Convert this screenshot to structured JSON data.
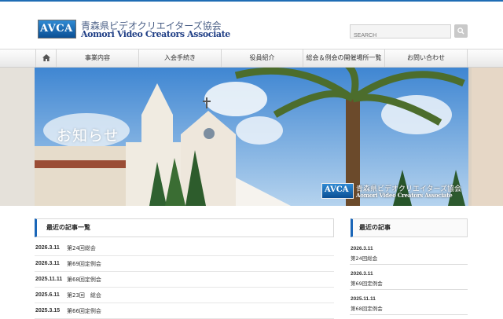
{
  "header": {
    "logo_mark": "AVCA",
    "logo_jp": "青森県ビデオクリエイターズ協会",
    "logo_en": "Aomori Video Creators Associate",
    "search_placeholder": "SEARCH",
    "search_button_icon": "search-icon"
  },
  "nav": {
    "home_icon": "home-icon",
    "items": [
      "事業内容",
      "入会手続き",
      "役員紹介",
      "総会＆例会の開催場所一覧",
      "お問い合わせ"
    ]
  },
  "hero": {
    "title": "お知らせ",
    "logo_mark": "AVCA",
    "logo_jp": "青森県ビデオクリエイターズ協会",
    "logo_en": "Aomori Video Creators Associate"
  },
  "main": {
    "heading": "最近の記事一覧",
    "posts": [
      {
        "date": "2026.3.11",
        "title": "第24回総会"
      },
      {
        "date": "2026.3.11",
        "title": "第69回定例会"
      },
      {
        "date": "2025.11.11",
        "title": "第68回定例会"
      },
      {
        "date": "2025.6.11",
        "title": "第23回　総会"
      },
      {
        "date": "2025.3.15",
        "title": "第66回定例会"
      }
    ]
  },
  "sidebar": {
    "heading": "最近の記事",
    "items": [
      {
        "date": "2026.3.11",
        "title": "第24回総会"
      },
      {
        "date": "2026.3.11",
        "title": "第69回定例会"
      },
      {
        "date": "2025.11.11",
        "title": "第68回定例会"
      }
    ]
  },
  "colors": {
    "accent": "#1a66b8",
    "top_line": "#1f6db5",
    "logo_text": "#203f86"
  }
}
